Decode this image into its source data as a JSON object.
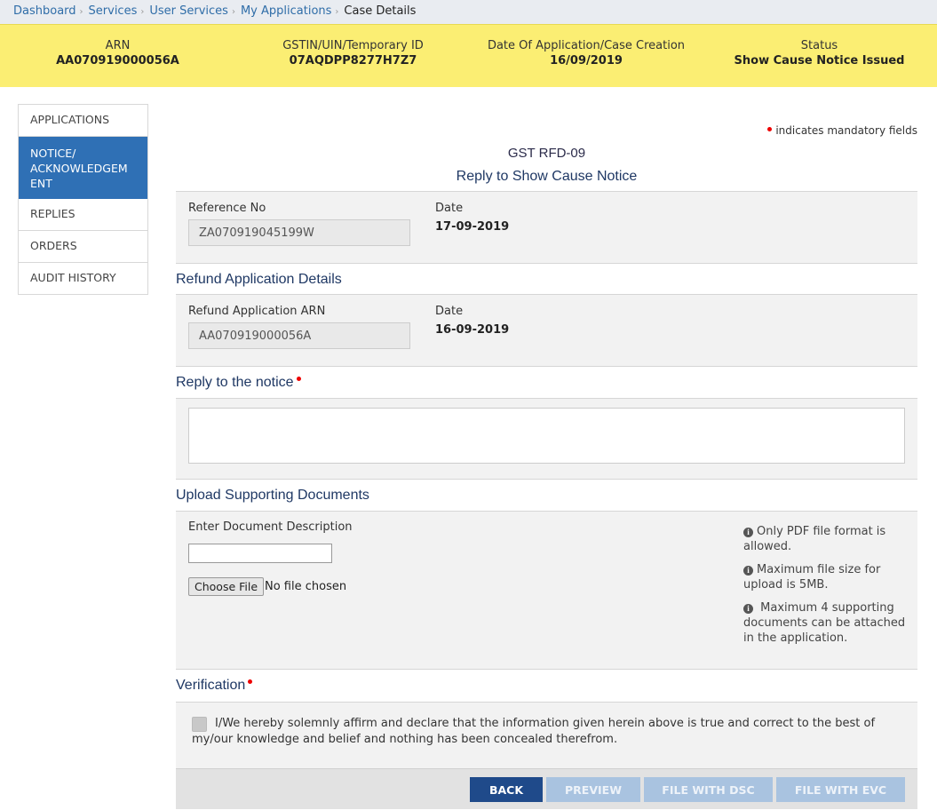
{
  "breadcrumb": {
    "items": [
      "Dashboard",
      "Services",
      "User Services",
      "My Applications"
    ],
    "current": "Case Details"
  },
  "case_header": {
    "arn_label": "ARN",
    "arn_value": "AA070919000056A",
    "gstin_label": "GSTIN/UIN/Temporary ID",
    "gstin_value": "07AQDPP8277H7Z7",
    "date_label": "Date Of Application/Case Creation",
    "date_value": "16/09/2019",
    "status_label": "Status",
    "status_value": "Show Cause Notice Issued"
  },
  "sidebar": {
    "items": [
      {
        "label": "APPLICATIONS"
      },
      {
        "label": "NOTICE/ ACKNOWLEDGEM ENT"
      },
      {
        "label": "REPLIES"
      },
      {
        "label": "ORDERS"
      },
      {
        "label": "AUDIT HISTORY"
      }
    ],
    "active_index": 1
  },
  "form": {
    "mandatory_note": "indicates mandatory fields",
    "title": "GST RFD-09",
    "subtitle": "Reply to Show Cause Notice",
    "reference": {
      "ref_label": "Reference No",
      "ref_value": "ZA070919045199W",
      "date_label": "Date",
      "date_value": "17-09-2019"
    },
    "refund_section": {
      "title": "Refund Application Details",
      "arn_label": "Refund Application ARN",
      "arn_value": "AA070919000056A",
      "date_label": "Date",
      "date_value": "16-09-2019"
    },
    "reply_section": {
      "title": "Reply to the notice",
      "value": ""
    },
    "upload_section": {
      "title": "Upload Supporting Documents",
      "desc_label": "Enter Document Description",
      "desc_value": "",
      "choose_file_label": "Choose File",
      "no_file_text": "No file chosen",
      "info": [
        "Only PDF file format is allowed.",
        "Maximum file size for upload is 5MB.",
        " Maximum 4 supporting documents can be attached in the application."
      ]
    },
    "verification": {
      "title": "Verification",
      "text": "I/We hereby solemnly affirm and declare that the information given herein above is true and correct to the best of my/our knowledge and belief and nothing has been concealed therefrom.",
      "checked": false
    },
    "buttons": {
      "back": "BACK",
      "preview": "PREVIEW",
      "file_dsc": "FILE WITH DSC",
      "file_evc": "FILE WITH EVC"
    }
  }
}
